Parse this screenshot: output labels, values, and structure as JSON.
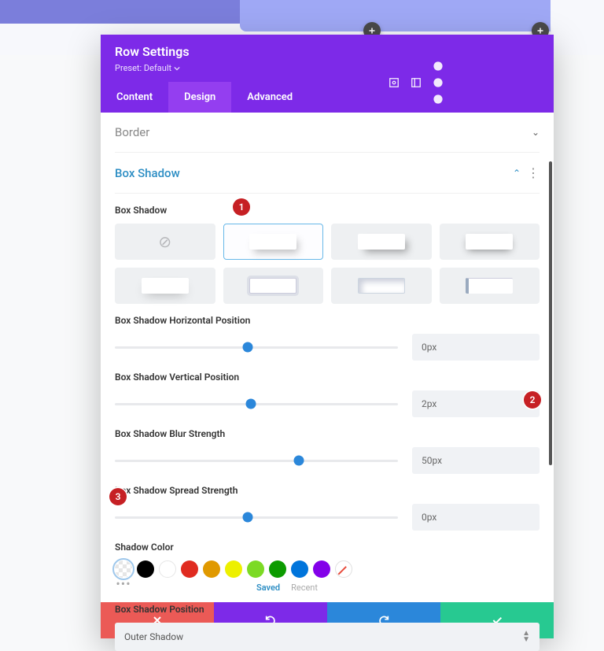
{
  "header": {
    "title": "Row Settings",
    "preset_label": "Preset: Default"
  },
  "tabs": [
    "Content",
    "Design",
    "Advanced"
  ],
  "active_tab": 1,
  "sections": {
    "border": {
      "title": "Border"
    },
    "box_shadow": {
      "title": "Box Shadow",
      "label": "Box Shadow",
      "selected_preset_index": 1,
      "sliders": {
        "hpos": {
          "label": "Box Shadow Horizontal Position",
          "value": "0px",
          "pct": 47
        },
        "vpos": {
          "label": "Box Shadow Vertical Position",
          "value": "2px",
          "pct": 48
        },
        "blur": {
          "label": "Box Shadow Blur Strength",
          "value": "50px",
          "pct": 65
        },
        "spread": {
          "label": "Box Shadow Spread Strength",
          "value": "0px",
          "pct": 47
        }
      },
      "color": {
        "label": "Shadow Color",
        "swatches": [
          "transparent",
          "#000000",
          "#ffffff",
          "#e02b20",
          "#e09900",
          "#edf000",
          "#7cda24",
          "#0c9b00",
          "#0074db",
          "#8300e9",
          "none"
        ],
        "tab_saved": "Saved",
        "tab_recent": "Recent"
      },
      "position": {
        "label": "Box Shadow Position",
        "value": "Outer Shadow"
      }
    }
  },
  "annotations": [
    "1",
    "2",
    "3"
  ]
}
